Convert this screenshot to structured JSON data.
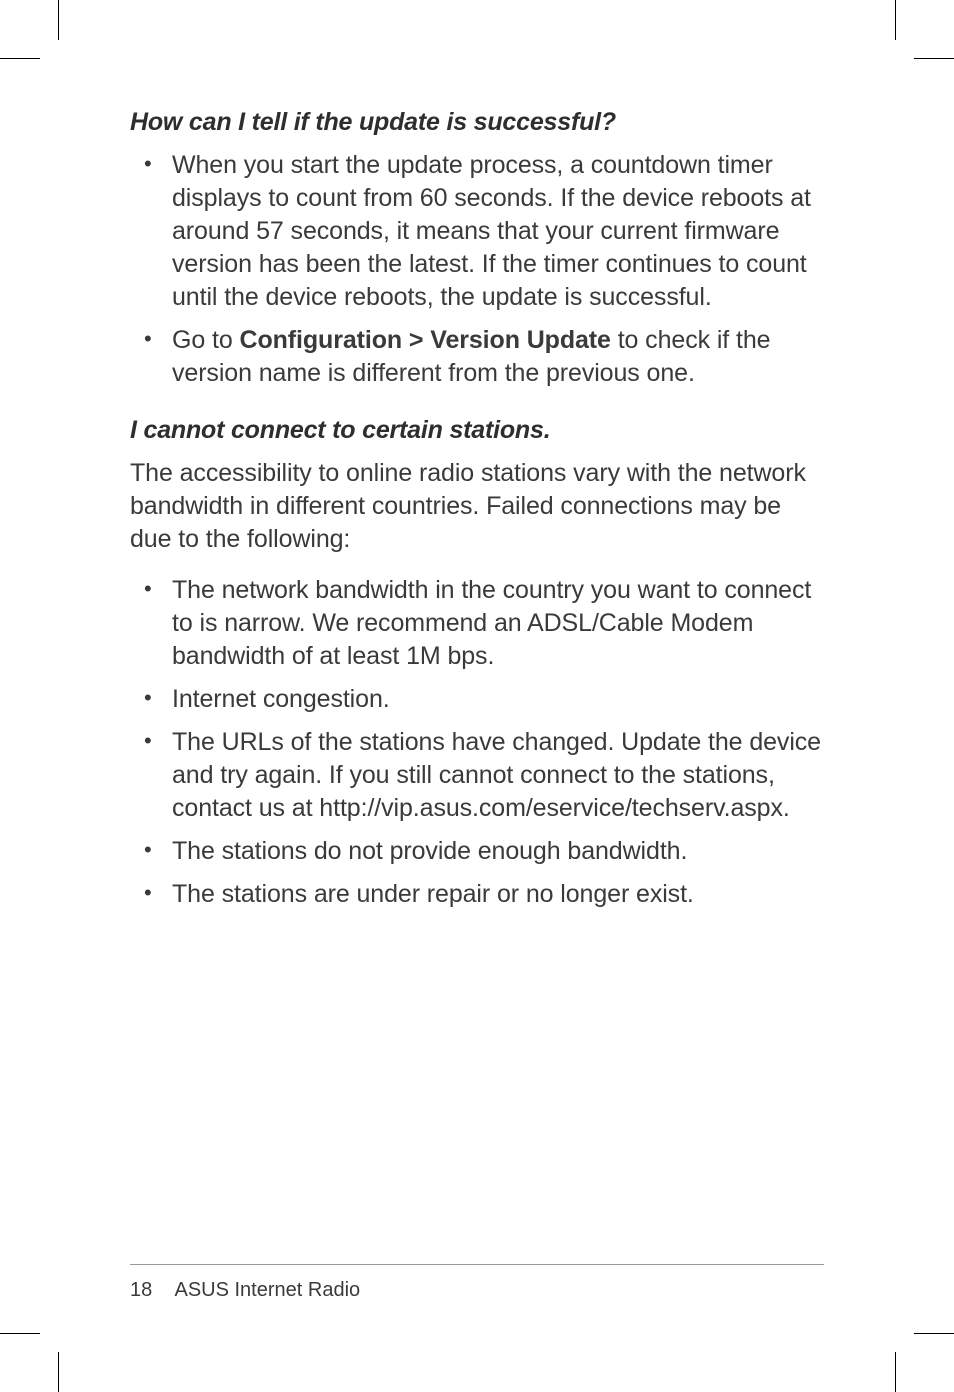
{
  "section1": {
    "heading": "How can I tell if the update is successful?",
    "items": [
      {
        "text": "When you start the update process, a countdown timer displays to count from 60 seconds. If the device reboots at around 57 seconds, it means that your current firmware version has been the latest. If the timer continues to count until the device reboots, the update is successful."
      },
      {
        "pre": "Go to ",
        "bold": "Configuration > Version Update",
        "post": " to check if the version name is different from the previous one."
      }
    ]
  },
  "section2": {
    "heading": "I cannot connect to certain stations.",
    "intro": "The accessibility to online radio stations vary with the network bandwidth in different countries. Failed connections may be due to the following:",
    "items": [
      "The network bandwidth in the country you want to connect to is narrow. We recommend an ADSL/Cable Modem bandwidth of at least 1M bps.",
      "Internet congestion.",
      "The URLs of the stations have changed. Update the device and try again. If you still cannot connect to the stations, contact us at http://vip.asus.com/eservice/techserv.aspx.",
      "The stations do not provide enough bandwidth.",
      "The stations are under repair or no longer exist."
    ]
  },
  "footer": {
    "page": "18",
    "title": "ASUS Internet Radio"
  }
}
